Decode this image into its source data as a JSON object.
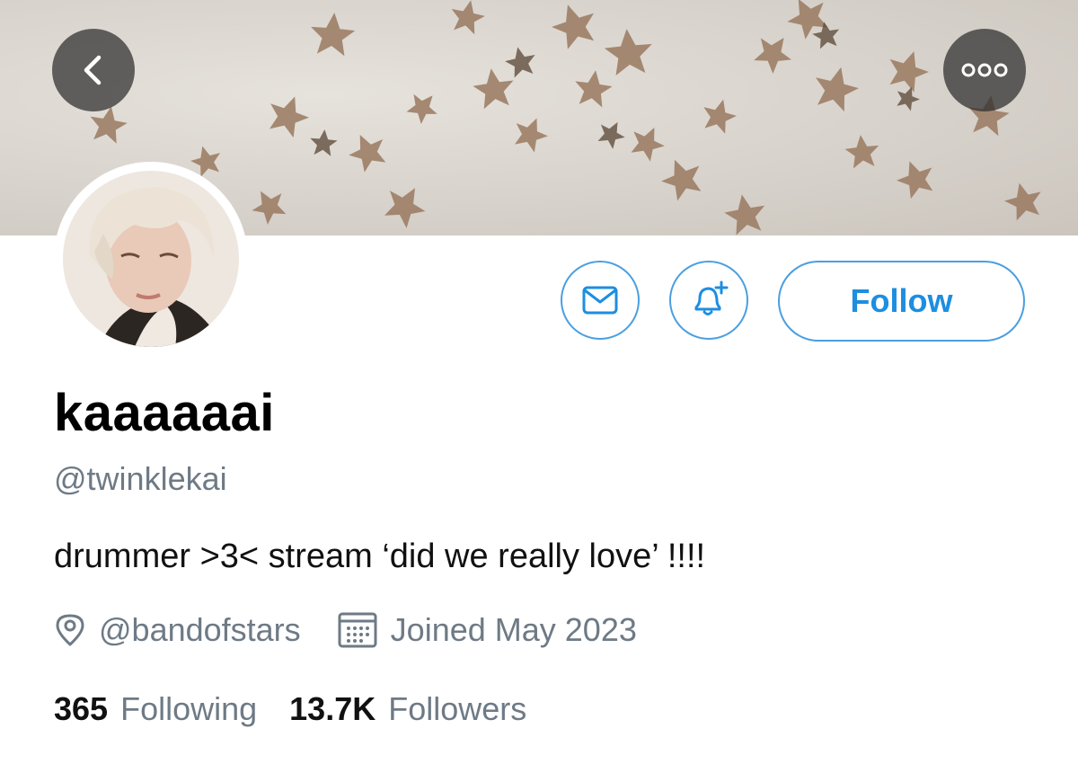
{
  "profile": {
    "display_name": "kaaaaaai",
    "handle": "@twinklekai",
    "bio": "drummer >3< stream ‘did we really love’ !!!!",
    "location": "@bandofstars",
    "joined": "Joined May 2023"
  },
  "actions": {
    "follow_label": "Follow",
    "message_icon": "envelope-icon",
    "notify_icon": "bell-plus-icon"
  },
  "nav": {
    "back_icon": "chevron-left-icon",
    "more_icon": "more-dots-icon"
  },
  "stats": {
    "following_count": "365",
    "following_label": "Following",
    "followers_count": "13.7K",
    "followers_label": "Followers"
  },
  "colors": {
    "accent": "#1d8ee0",
    "secondary_text": "#6e7a85",
    "banner_stars": "#8a6a52"
  }
}
